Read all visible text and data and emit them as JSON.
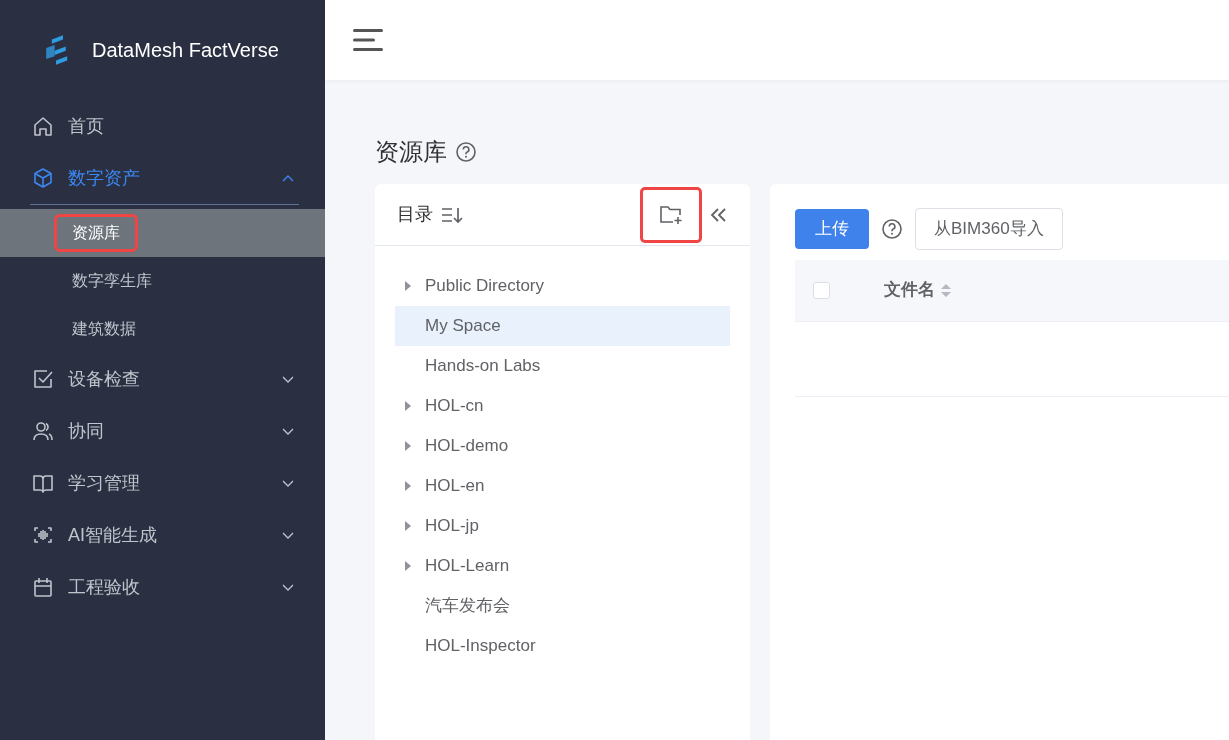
{
  "sidebar": {
    "brand": "DataMesh FactVerse",
    "items": [
      {
        "kind": "link",
        "label": "首页",
        "active": false
      },
      {
        "kind": "group",
        "label": "数字资产",
        "active": true,
        "expanded": true,
        "children": [
          {
            "label": "资源库",
            "selected": true,
            "highlighted": true
          },
          {
            "label": "数字孪生库",
            "selected": false,
            "highlighted": false
          },
          {
            "label": "建筑数据",
            "selected": false,
            "highlighted": false
          }
        ]
      },
      {
        "kind": "group",
        "label": "设备检查",
        "active": false,
        "expanded": false
      },
      {
        "kind": "group",
        "label": "协同",
        "active": false,
        "expanded": false
      },
      {
        "kind": "group",
        "label": "学习管理",
        "active": false,
        "expanded": false
      },
      {
        "kind": "group",
        "label": "AI智能生成",
        "active": false,
        "expanded": false
      },
      {
        "kind": "group",
        "label": "工程验收",
        "active": false,
        "expanded": false
      }
    ]
  },
  "page_title": "资源库",
  "directory": {
    "title": "目录",
    "new_folder_highlighted": true,
    "nodes": [
      {
        "label": "Public Directory",
        "expandable": true,
        "selected": false
      },
      {
        "label": "My Space",
        "expandable": false,
        "selected": true
      },
      {
        "label": "Hands-on Labs",
        "expandable": false,
        "selected": false
      },
      {
        "label": "HOL-cn",
        "expandable": true,
        "selected": false
      },
      {
        "label": "HOL-demo",
        "expandable": true,
        "selected": false
      },
      {
        "label": "HOL-en",
        "expandable": true,
        "selected": false
      },
      {
        "label": "HOL-jp",
        "expandable": true,
        "selected": false
      },
      {
        "label": "HOL-Learn",
        "expandable": true,
        "selected": false
      },
      {
        "label": "汽车发布会",
        "expandable": false,
        "selected": false
      },
      {
        "label": "HOL-Inspector",
        "expandable": false,
        "selected": false
      }
    ]
  },
  "toolbar": {
    "upload_button": "上传",
    "import_button": "从BIM360导入"
  },
  "table": {
    "select_all_checked": false,
    "columns": [
      "文件名"
    ]
  }
}
